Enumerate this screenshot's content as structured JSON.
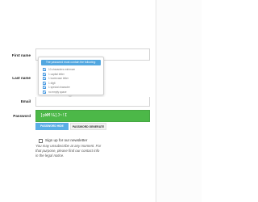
{
  "form": {
    "first_name_label": "First name",
    "last_name_label": "Last name",
    "email_label": "Email",
    "password_label": "Password",
    "first_name_value": "",
    "last_name_value": "",
    "email_value": "",
    "password_value": "]pWM!&]J~!I"
  },
  "tooltip": {
    "header": "The password must contain the following:",
    "rules": [
      {
        "label": "10 characters minimum",
        "checked": true
      },
      {
        "label": "1 capital letter",
        "checked": true
      },
      {
        "label": "1 lowercase letter",
        "checked": true
      },
      {
        "label": "1 digit",
        "checked": true
      },
      {
        "label": "1 special character",
        "checked": true
      },
      {
        "label": "no empty space",
        "checked": true
      }
    ]
  },
  "password_actions": {
    "hide_label": "PASSWORD HIDE",
    "generate_label": "PASSWORD GENERATE"
  },
  "newsletter": {
    "label": "Sign up for our newsletter",
    "checked": false,
    "note_line1": "You may unsubscribe at any moment. For",
    "note_line2": "that purpose, please find our contact info",
    "note_line3": "in the legal notice."
  },
  "colors": {
    "accent_blue": "#52a7e0",
    "checkbox_blue": "#3d93df",
    "password_green": "#4cb848"
  }
}
